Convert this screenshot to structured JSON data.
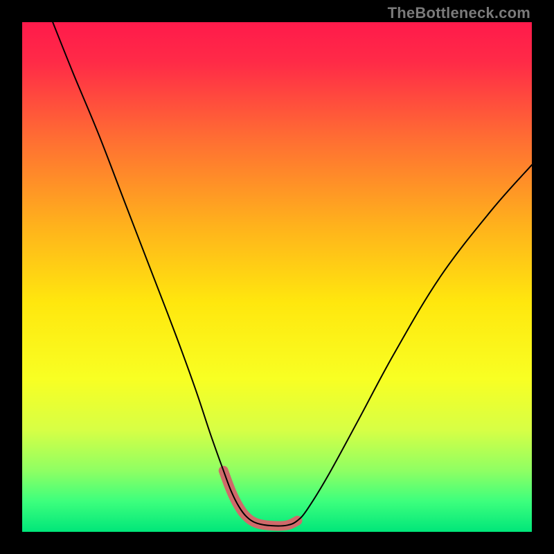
{
  "watermark": "TheBottleneck.com",
  "chart_data": {
    "type": "line",
    "title": "",
    "xlabel": "",
    "ylabel": "",
    "xlim": [
      0,
      100
    ],
    "ylim": [
      0,
      100
    ],
    "grid": false,
    "legend": false,
    "gradient_stops": [
      {
        "offset": 0.0,
        "color": "#ff1a4b"
      },
      {
        "offset": 0.08,
        "color": "#ff2b47"
      },
      {
        "offset": 0.22,
        "color": "#ff6a34"
      },
      {
        "offset": 0.4,
        "color": "#ffb21c"
      },
      {
        "offset": 0.55,
        "color": "#ffe70e"
      },
      {
        "offset": 0.7,
        "color": "#f8ff23"
      },
      {
        "offset": 0.8,
        "color": "#d7ff45"
      },
      {
        "offset": 0.88,
        "color": "#8fff63"
      },
      {
        "offset": 0.94,
        "color": "#3dff7d"
      },
      {
        "offset": 1.0,
        "color": "#00e67a"
      }
    ],
    "series": [
      {
        "name": "bottleneck-curve",
        "stroke": "#000000",
        "stroke_width": 2,
        "x": [
          6,
          10,
          15,
          20,
          25,
          30,
          34,
          37,
          39.5,
          41,
          42.5,
          44,
          46,
          49,
          52,
          54,
          56,
          60,
          66,
          73,
          82,
          92,
          100
        ],
        "y": [
          100,
          90,
          78,
          65,
          52,
          39,
          28,
          19,
          12,
          8,
          5,
          3,
          1.7,
          1.2,
          1.3,
          2.2,
          4.5,
          11,
          22,
          35,
          50,
          63,
          72
        ]
      }
    ],
    "highlight_segment": {
      "name": "flat-bottom-marker",
      "stroke": "#cf6a6a",
      "stroke_width": 14,
      "linecap": "round",
      "x": [
        39.5,
        41,
        42.5,
        44,
        46,
        49,
        52,
        54
      ],
      "y": [
        12,
        8,
        5,
        3,
        1.7,
        1.2,
        1.3,
        2.2
      ]
    }
  }
}
